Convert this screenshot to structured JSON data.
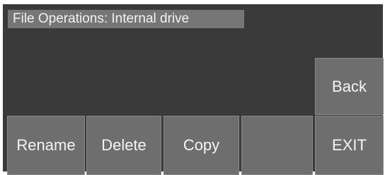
{
  "window": {
    "title": "File Operations:  Internal drive"
  },
  "buttons": {
    "back": "Back",
    "rename": "Rename",
    "delete": "Delete",
    "copy": "Copy",
    "empty": "",
    "exit": "EXIT"
  },
  "colors": {
    "screen_background": "#3a3a3a",
    "title_bar_background": "#767676",
    "button_background": "#6e6e6e",
    "text": "#f4f4f4"
  }
}
